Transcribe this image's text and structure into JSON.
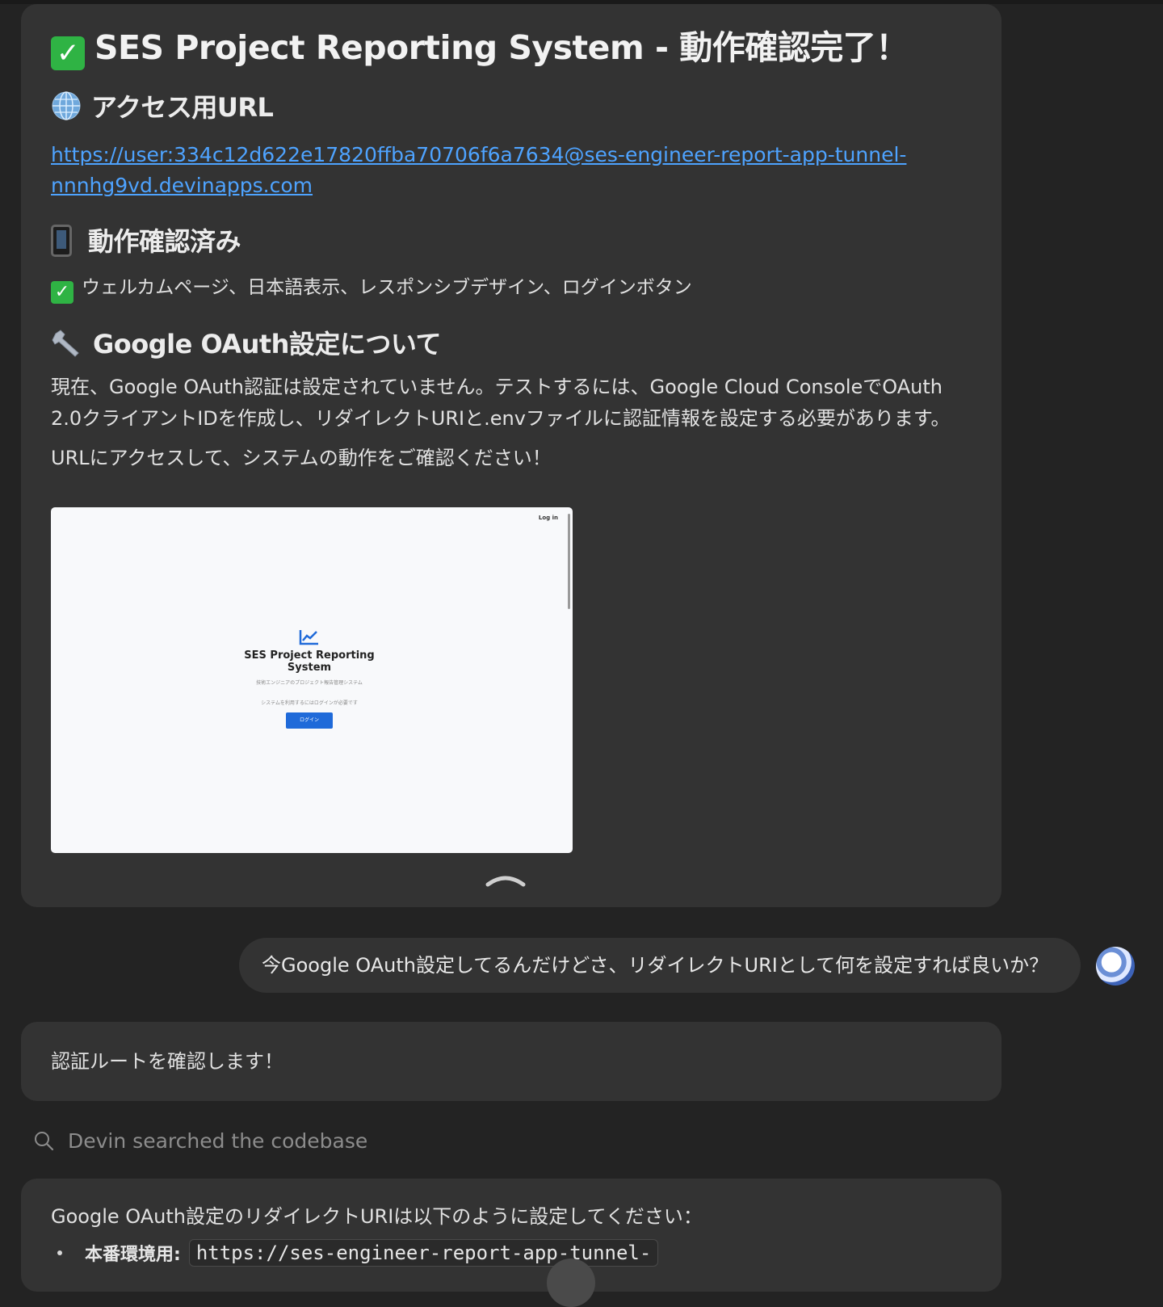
{
  "card1": {
    "title": "SES Project Reporting System - 動作確認完了！",
    "url_heading": "アクセス用URL",
    "url_line1": "https://user:334c12d622e17820ffba70706f6a7634@ses-engineer-report-app-tunnel-",
    "url_line2": "nnnhg9vd.devinapps.com",
    "verified_heading": "動作確認済み",
    "verified_text": "ウェルカムページ、日本語表示、レスポンシブデザイン、ログインボタン",
    "oauth_heading": "Google OAuth設定について",
    "oauth_para_line1": "現在、Google OAuth認証は設定されていません。テストするには、Google Cloud ConsoleでOAuth",
    "oauth_para_line2": "2.0クライアントIDを作成し、リダイレクトURIと.envファイルに認証情報を設定する必要があります。",
    "closing": "URLにアクセスして、システムの動作をご確認ください！",
    "screenshot": {
      "login": "Log in",
      "title_line1": "SES Project Reporting",
      "title_line2": "System",
      "subtitle": "技術エンジニアのプロジェクト報告管理システム",
      "prompt": "システムを利用するにはログインが必要です",
      "button": "ログイン"
    }
  },
  "user_message": "今Google OAuth設定してるんだけどさ、リダイレクトURIとして何を設定すれば良いか？",
  "card2": {
    "text": "認証ルートを確認します！"
  },
  "search_activity": "Devin searched the codebase",
  "card3": {
    "intro": "Google OAuth設定のリダイレクトURIは以下のように設定してください：",
    "bullet_label": "本番環境用:",
    "bullet_code": "https://ses-engineer-report-app-tunnel-"
  },
  "colors": {
    "link": "#4ea3ff",
    "check": "#2fb344",
    "card": "#333333",
    "background": "#232323"
  },
  "icons": [
    "check-icon",
    "globe-icon",
    "phone-icon",
    "wrench-icon",
    "search-icon",
    "chevron-up-icon",
    "chart-icon"
  ]
}
